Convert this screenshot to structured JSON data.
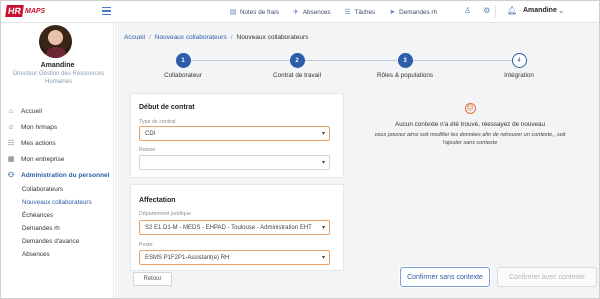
{
  "brand": {
    "hr": "HR",
    "maps": "MAPS"
  },
  "topnav": [
    {
      "label": "Notes de frais",
      "icon": "receipt-icon"
    },
    {
      "label": "Absences",
      "icon": "plane-icon"
    },
    {
      "label": "Tâches",
      "icon": "tasks-icon"
    },
    {
      "label": "Demandes rh",
      "icon": "send-icon"
    }
  ],
  "user": {
    "name": "Amandine",
    "role": "Directeur Gestion des Ressources Humaines"
  },
  "menu": [
    {
      "label": "Accueil",
      "icon": "home-icon"
    },
    {
      "label": "Mon hrmaps",
      "icon": "user-icon"
    },
    {
      "label": "Mes actions",
      "icon": "actions-icon"
    },
    {
      "label": "Mon entreprise",
      "icon": "building-icon"
    },
    {
      "label": "Administration du personnel",
      "icon": "people-icon"
    }
  ],
  "submenu": [
    "Collaborateurs",
    "Nouveaux collaborateurs",
    "Échéances",
    "Demandes rh",
    "Demandes d'avance",
    "Absences"
  ],
  "breadcrumb": {
    "home": "Accueil",
    "section": "Nouveaux collaborateurs",
    "current": "Nouveaux collaborateurs"
  },
  "steps": [
    {
      "num": "1",
      "label": "Collaborateur"
    },
    {
      "num": "2",
      "label": "Contrat de travail"
    },
    {
      "num": "3",
      "label": "Rôles & populations"
    },
    {
      "num": "4",
      "label": "Intégration"
    }
  ],
  "contract": {
    "title": "Début de contrat",
    "type_label": "Type de contrat",
    "type_value": "CDI",
    "reason_label": "Raison",
    "reason_value": ""
  },
  "affectation": {
    "title": "Affectation",
    "dept_label": "Département juridique",
    "dept_value": "S2 E1 D1-M - MEDS - EHPAD - Toulouse - Administration EHT",
    "poste_label": "Poste",
    "poste_value": "ESMS P1F2P1-Assistant(e) RH"
  },
  "empty_state": {
    "title": "Aucun contexte n'a été trouvé, réessayez de nouveau",
    "subtitle": "vous pouvez ainsi soit modifier les données afin de retrouver un contexte,, soit l'ajouter sans contexte"
  },
  "buttons": {
    "back": "Retour",
    "confirm_no_ctx": "Confirmer sans contexte",
    "confirm_ctx": "Confirmer avec contexte"
  },
  "colors": {
    "brand": "#c8102e",
    "accent": "#2c5da8",
    "warning": "#e9a36a"
  }
}
